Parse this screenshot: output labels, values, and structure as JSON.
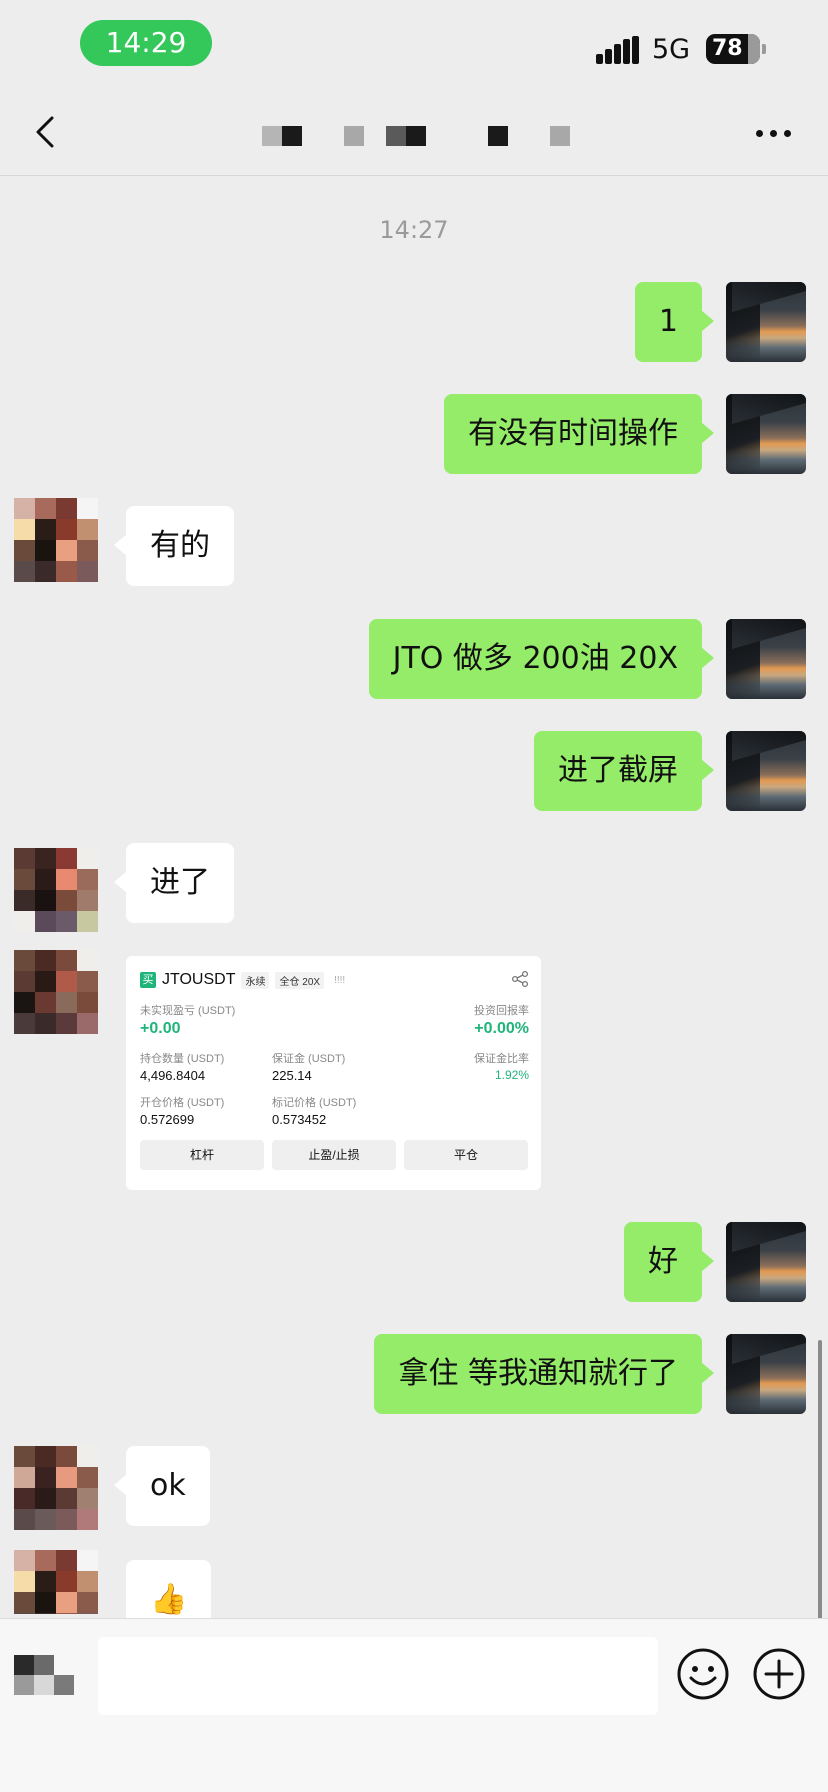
{
  "status": {
    "time": "14:29",
    "network": "5G",
    "battery": "78"
  },
  "nav": {
    "back_label": "<",
    "more_label": "..."
  },
  "timestamp": "14:27",
  "messages": [
    {
      "text": "1"
    },
    {
      "text": "有没有时间操作"
    },
    {
      "text": "有的"
    },
    {
      "text": "JTO 做多 200油 20X"
    },
    {
      "text": "进了截屏"
    },
    {
      "text": "进了"
    },
    {
      "text": "好"
    },
    {
      "text": "拿住 等我通知就行了"
    },
    {
      "text": "ok"
    },
    {
      "text": "👍"
    }
  ],
  "card": {
    "buy_badge": "买",
    "symbol": "JTOUSDT",
    "type_tag": "永续",
    "leverage_tag": "全仓 20X",
    "bars": "!!!!",
    "unrealized_label": "未实现盈亏 (USDT)",
    "unrealized_value": "+0.00",
    "roi_label": "投资回报率",
    "roi_value": "+0.00%",
    "position_label": "持仓数量 (USDT)",
    "position_value": "4,496.8404",
    "margin_label": "保证金 (USDT)",
    "margin_value": "225.14",
    "margin_ratio_label": "保证金比率",
    "margin_ratio_value": "1.92%",
    "entry_label": "开仓价格 (USDT)",
    "entry_value": "0.572699",
    "mark_label": "标记价格 (USDT)",
    "mark_value": "0.573452",
    "btn_leverage": "杠杆",
    "btn_tpsl": "止盈/止损",
    "btn_close": "平仓"
  },
  "input": {
    "placeholder": ""
  },
  "colors": {
    "self_bubble": "#95ec69",
    "other_bubble": "#ffffff",
    "status_pill": "#34c759",
    "profit": "#1fb57a"
  }
}
